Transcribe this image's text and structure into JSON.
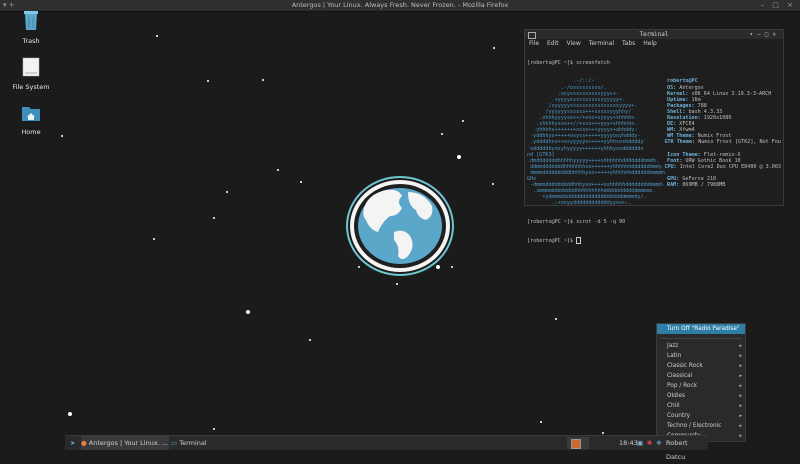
{
  "window": {
    "title": "Antergos | Your Linux. Always Fresh. Never Frozen. - Mozilla Firefox"
  },
  "desktop": {
    "icons": [
      {
        "label": "Trash",
        "icon": "trash-icon"
      },
      {
        "label": "File System",
        "icon": "drive-icon"
      },
      {
        "label": "Home",
        "icon": "home-folder-icon"
      }
    ]
  },
  "terminal": {
    "title": "Terminal",
    "menu": [
      "File",
      "Edit",
      "View",
      "Terminal",
      "Tabs",
      "Help"
    ],
    "prompt1": "[roberto@PC ~]$ screenfetch",
    "art": [
      "              `.-/::/-``",
      "           .-/osssssssso/.",
      "          :osyssssssssssyyys+-",
      "       `.+yyyysssssssssssyyyyy+.",
      "      `/syyyyyssssssssssssssssyyyy+.",
      "     `/yyyyyyssssss+++sssssyyyhhy/`",
      "    .ohhhyyyyso++/+oso+syyyy+shhhho.",
      "   .shhhhysoo++//+sss+++yyy+shhhhho.",
      "  -yhhhhs+++++++osso+++yyyys+ahhddy:",
      " -yddhhyo+++++osyss+++++yyyyooyhdddy-",
      " .yddddhso++osyyyyys+++++yyhhsoshddddy`",
      "`odddddhyosyhyyyyy++++++yhhhyosddddddo",
      "nd [GTK3]",
      ".dmdddddddhhhhhyyyyy++++shhhhhhdddddddmmdh.",
      " ddmmdddddddhhhhhhhso++++++yhhhhhhddddddmmdy",
      " dmmmdddddddddhhhhhyso+++++yhhhhhhddddddmmmmh",
      "GHz",
      " -dmmmdddddddddhhhyso++++oshhhhhddddddddmmmd-",
      "  .smmmmddddddddhhhhhhhhhdddddddddddmmmms.",
      "    `+ydmmmdddddddddddddddddddddmmmdy/.",
      "       `.:+ooyyddddddddddddyyso+:."
    ],
    "info": [
      {
        "k": "roberto@PC",
        "v": ""
      },
      {
        "k": "OS:",
        "v": "Antergos"
      },
      {
        "k": "Kernel:",
        "v": "x86_64 Linux 3.19.3-3-ARCH"
      },
      {
        "k": "Uptime:",
        "v": "16m"
      },
      {
        "k": "Packages:",
        "v": "788"
      },
      {
        "k": "Shell:",
        "v": "bash 4.3.33"
      },
      {
        "k": "Resolution:",
        "v": "1920x1080"
      },
      {
        "k": "DE:",
        "v": "XFCE4"
      },
      {
        "k": "WM:",
        "v": "Xfwm4"
      },
      {
        "k": "WM Theme:",
        "v": "Numix Frost"
      },
      {
        "k": "GTK Theme:",
        "v": "Numix Frost [GTK2], Not Fou"
      },
      {
        "k": "",
        "v": ""
      },
      {
        "k": "Icon Theme:",
        "v": "Flat-remix-X"
      },
      {
        "k": "Font:",
        "v": "URW Gothic Book 10"
      },
      {
        "k": "CPU:",
        "v": "Intel Core2 Duo CPU E8400 @ 3.003"
      },
      {
        "k": "",
        "v": ""
      },
      {
        "k": "GPU:",
        "v": "GeForce 210"
      },
      {
        "k": "RAM:",
        "v": "869MB / 7988MB"
      }
    ],
    "prompt2": "[roberto@PC ~]$ scrot -d 5 -q 90",
    "prompt3": "[roberto@PC ~]$ "
  },
  "context_menu": {
    "highlighted": "Turn Off \"Radio Paradise\"",
    "items": [
      "Jazz",
      "Latin",
      "Classic Rock",
      "Classical",
      "Pop / Rock",
      "Oldies",
      "Chill",
      "Country",
      "Techno / Electronic",
      "Community"
    ]
  },
  "taskbar": {
    "tasks": [
      "Antergos | Your Linux. ...",
      "Terminal"
    ],
    "clock": "18:43",
    "user": "Robert Datcu"
  },
  "colors": {
    "accent": "#2d7fa8",
    "globe": "#5aa7c9",
    "ring": "#6ec6d2"
  }
}
